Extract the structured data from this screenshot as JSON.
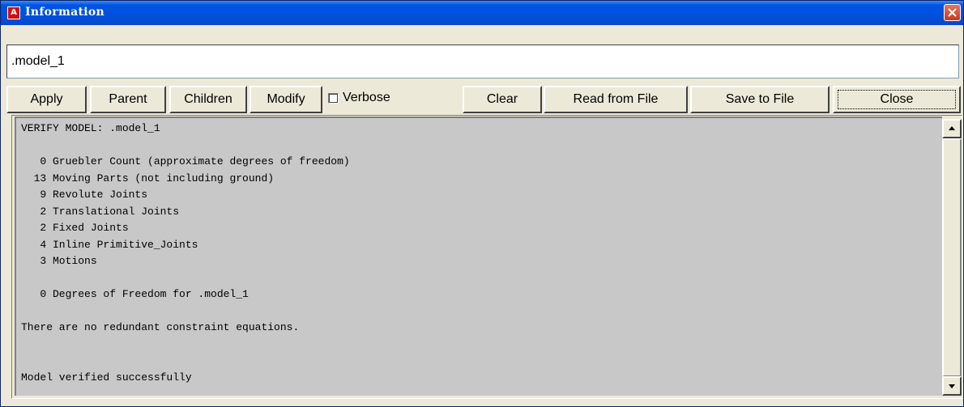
{
  "window": {
    "title": "Information",
    "app_icon_letter": "A"
  },
  "model_field": {
    "value": ".model_1"
  },
  "toolbar": {
    "apply": "Apply",
    "parent": "Parent",
    "children": "Children",
    "modify": "Modify",
    "verbose": "Verbose",
    "verbose_checked": false,
    "clear": "Clear",
    "read_from_file": "Read from File",
    "save_to_file": "Save to File",
    "close": "Close"
  },
  "output": {
    "lines": [
      "VERIFY MODEL: .model_1",
      "",
      "   0 Gruebler Count (approximate degrees of freedom)",
      "  13 Moving Parts (not including ground)",
      "   9 Revolute Joints",
      "   2 Translational Joints",
      "   2 Fixed Joints",
      "   4 Inline Primitive_Joints",
      "   3 Motions",
      "",
      "   0 Degrees of Freedom for .model_1",
      "",
      "There are no redundant constraint equations.",
      "",
      "",
      "Model verified successfully"
    ]
  },
  "colors": {
    "titlebar": "#0054e3",
    "output_bg": "#c8c8c8",
    "window_bg": "#ece9d8",
    "close_button": "#d9533a"
  },
  "icons": {
    "app": "app-a-icon",
    "close": "close-x-icon",
    "scroll_up": "arrow-up-icon",
    "scroll_down": "arrow-down-icon"
  }
}
